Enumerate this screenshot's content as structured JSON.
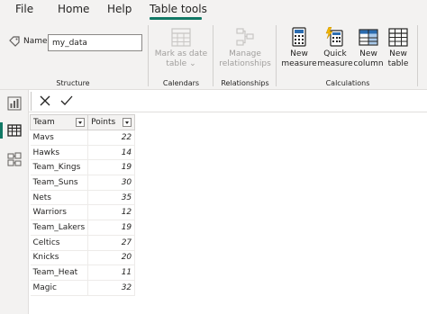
{
  "menu": {
    "file": "File",
    "home": "Home",
    "help": "Help",
    "table_tools": "Table tools"
  },
  "ribbon": {
    "structure": {
      "name_label": "Name",
      "name_value": "my_data",
      "group_label": "Structure"
    },
    "calendars": {
      "mark_as_date_line1": "Mark as date",
      "mark_as_date_line2": "table",
      "group_label": "Calendars"
    },
    "relationships": {
      "manage_line1": "Manage",
      "manage_line2": "relationships",
      "group_label": "Relationships"
    },
    "calculations": {
      "new_measure_line1": "New",
      "new_measure_line2": "measure",
      "quick_measure_line1": "Quick",
      "quick_measure_line2": "measure",
      "new_column_line1": "New",
      "new_column_line2": "column",
      "new_table_line1": "New",
      "new_table_line2": "table",
      "group_label": "Calculations"
    }
  },
  "colors": {
    "accent": "#117865",
    "ribbon_bg": "#f3f2f1",
    "disabled_text": "#a19f9d"
  },
  "left_nav": {
    "icons": [
      "report-view-icon",
      "table-view-icon",
      "model-view-icon"
    ]
  },
  "table": {
    "columns": [
      "Team",
      "Points"
    ],
    "rows": [
      [
        "Mavs",
        "22"
      ],
      [
        "Hawks",
        "14"
      ],
      [
        "Team_Kings",
        "19"
      ],
      [
        "Team_Suns",
        "30"
      ],
      [
        "Nets",
        "35"
      ],
      [
        "Warriors",
        "12"
      ],
      [
        "Team_Lakers",
        "19"
      ],
      [
        "Celtics",
        "27"
      ],
      [
        "Knicks",
        "20"
      ],
      [
        "Team_Heat",
        "11"
      ],
      [
        "Magic",
        "32"
      ]
    ]
  }
}
